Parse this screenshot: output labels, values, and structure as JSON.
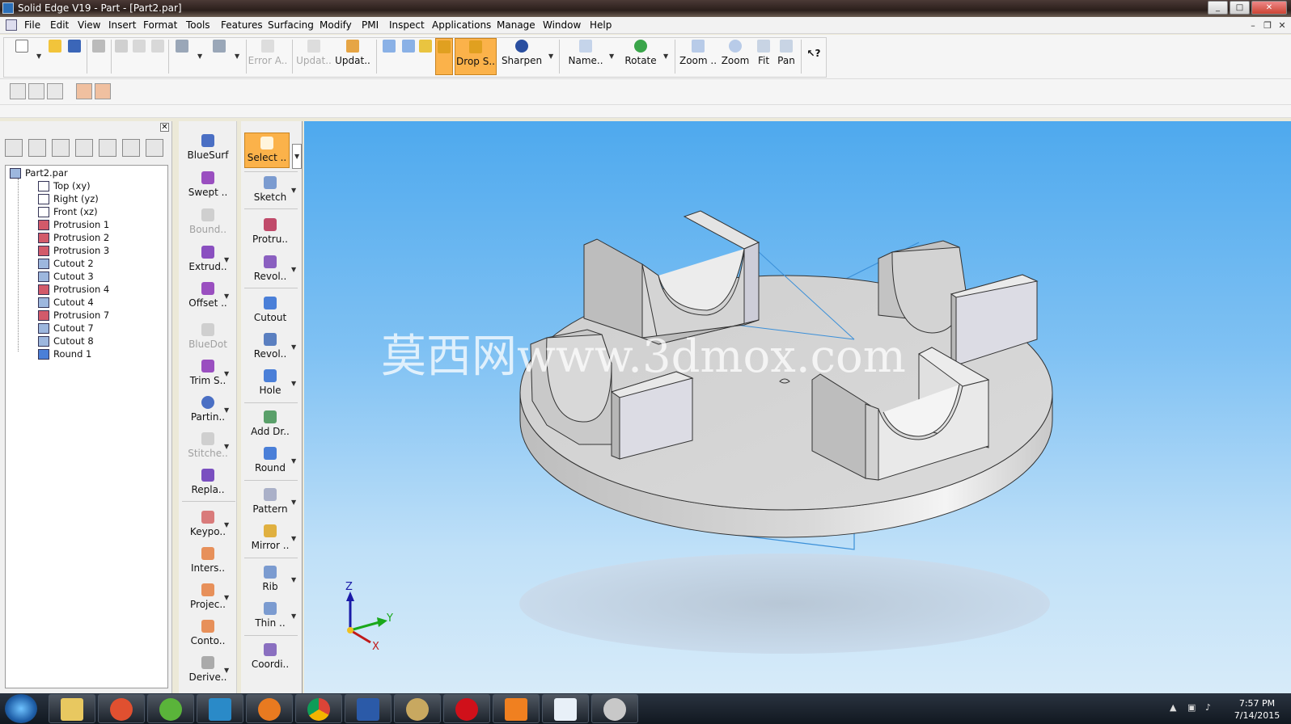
{
  "window": {
    "title": "Solid Edge V19 - Part - [Part2.par]"
  },
  "menu": [
    "File",
    "Edit",
    "View",
    "Insert",
    "Format",
    "Tools",
    "Features",
    "Surfacing",
    "Modify",
    "PMI",
    "Inspect",
    "Applications",
    "Manage",
    "Window",
    "Help"
  ],
  "toolbar": {
    "error_assistant": "Error A..",
    "update1": "Updat..",
    "update2": "Updat..",
    "drop_shadow": "Drop S..",
    "sharpen": "Sharpen",
    "named_views": "Name..",
    "rotate": "Rotate",
    "zoom_area": "Zoom ..",
    "zoom": "Zoom",
    "fit": "Fit",
    "pan": "Pan"
  },
  "pathfinder": {
    "root": "Part2.par",
    "items": [
      "Top (xy)",
      "Right (yz)",
      "Front (xz)",
      "Protrusion 1",
      "Protrusion 2",
      "Protrusion 3",
      "Cutout 2",
      "Cutout 3",
      "Protrusion 4",
      "Cutout 4",
      "Protrusion 7",
      "Cutout 7",
      "Cutout 8",
      "Round 1"
    ]
  },
  "surfacing_ribbon": [
    "BlueSurf",
    "Swept ..",
    "Bound..",
    "Extrud..",
    "Offset ..",
    "BlueDot",
    "Trim S..",
    "Partin..",
    "Stitche..",
    "Repla..",
    "Keypo..",
    "Inters..",
    "Projec..",
    "Conto..",
    "Derive.."
  ],
  "features_ribbon": [
    "Select ..",
    "Sketch",
    "Protru..",
    "Revol..",
    "Cutout",
    "Revol..",
    "Hole",
    "Add Dr..",
    "Round",
    "Pattern",
    "Mirror ..",
    "Rib",
    "Thin ..",
    "Coordi.."
  ],
  "viewport": {
    "watermark": "莫西网www.3dmox.com",
    "triad": {
      "z": "Z",
      "y": "Y",
      "x": "X"
    }
  },
  "taskbar": {
    "time": "7:57 PM",
    "date": "7/14/2015"
  },
  "colors": {
    "drop_shadow_active": "#fbb24a",
    "viewport_top": "#4ea9ee",
    "viewport_bottom": "#d7ebf9"
  }
}
